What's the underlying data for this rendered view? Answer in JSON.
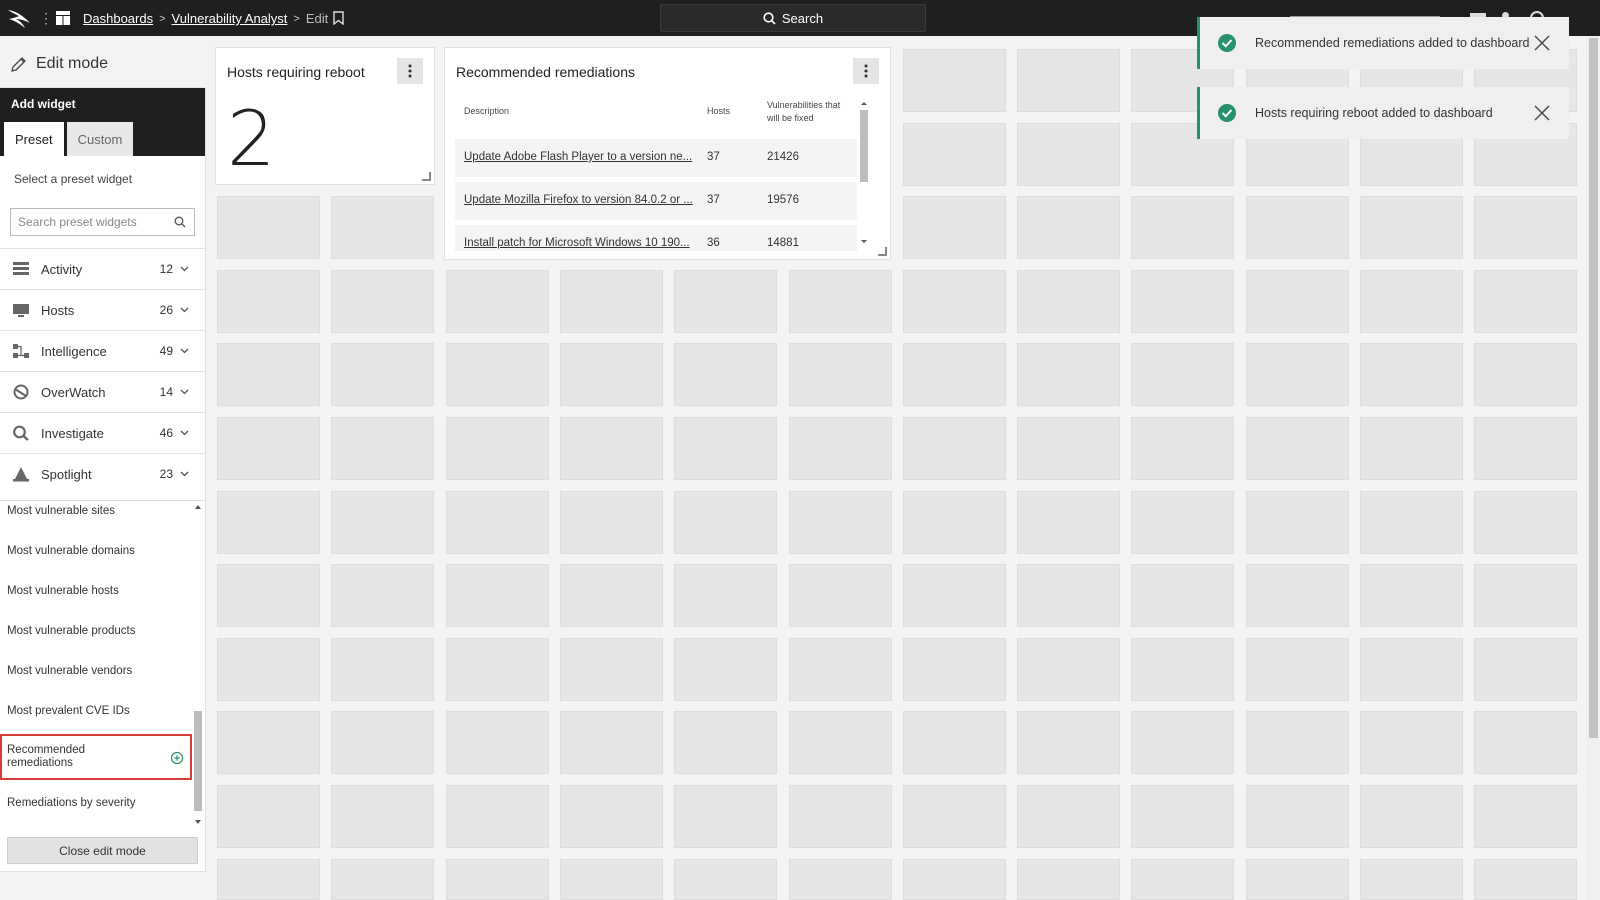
{
  "topbar": {
    "breadcrumbs": [
      "Dashboards",
      "Vulnerability Analyst"
    ],
    "current": "Edit",
    "search_label": "Search"
  },
  "left": {
    "edit_mode_label": "Edit mode",
    "panel_title": "Add widget",
    "tabs": [
      "Preset",
      "Custom"
    ],
    "select_label": "Select a preset widget",
    "search_placeholder": "Search preset widgets",
    "categories": [
      {
        "label": "Activity",
        "count": "12",
        "icon": "activity-icon"
      },
      {
        "label": "Hosts",
        "count": "26",
        "icon": "hosts-icon"
      },
      {
        "label": "Intelligence",
        "count": "49",
        "icon": "intelligence-icon"
      },
      {
        "label": "OverWatch",
        "count": "14",
        "icon": "overwatch-icon"
      },
      {
        "label": "Investigate",
        "count": "46",
        "icon": "investigate-icon"
      },
      {
        "label": "Spotlight",
        "count": "23",
        "icon": "spotlight-icon"
      }
    ],
    "items": [
      "Most vulnerable sites",
      "Most vulnerable domains",
      "Most vulnerable hosts",
      "Most vulnerable products",
      "Most vulnerable vendors",
      "Most prevalent CVE IDs",
      "Recommended remediations",
      "Remediations by severity"
    ],
    "close_label": "Close edit mode"
  },
  "widgets": {
    "reboot": {
      "title": "Hosts requiring reboot",
      "value": "2"
    },
    "remediations": {
      "title": "Recommended remediations",
      "columns": [
        "Description",
        "Hosts",
        "Vulnerabilities that will be fixed"
      ],
      "rows": [
        {
          "desc": "Update Adobe Flash Player to a version ne...",
          "hosts": "37",
          "vulns": "21426"
        },
        {
          "desc": "Update Mozilla Firefox to version 84.0.2 or ...",
          "hosts": "37",
          "vulns": "19576"
        },
        {
          "desc": "Install patch for Microsoft Windows 10 190...",
          "hosts": "36",
          "vulns": "14881"
        }
      ]
    }
  },
  "toasts": [
    "Recommended remediations added to dashboard",
    "Hosts requiring reboot added to dashboard"
  ],
  "colors": {
    "topbar": "#1f1f1f",
    "success": "#27916f",
    "selection": "#d93a3a"
  }
}
